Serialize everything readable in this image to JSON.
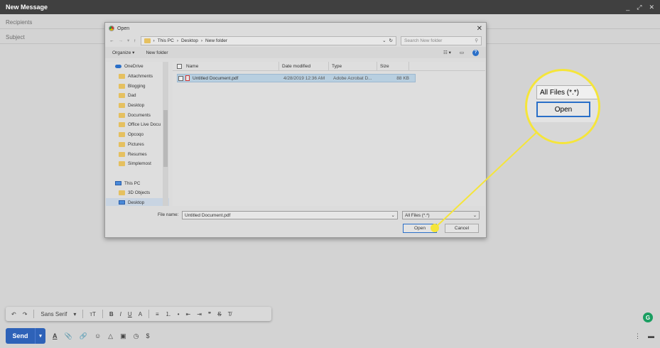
{
  "compose": {
    "title": "New Message",
    "minimize": "_",
    "expand": "⤢",
    "close": "✕",
    "recipients_placeholder": "Recipients",
    "subject_placeholder": "Subject"
  },
  "format_toolbar": {
    "font": "Sans Serif",
    "undo": "↶",
    "redo": "↷",
    "size": "тT",
    "bold": "B",
    "italic": "I",
    "underline": "U",
    "color": "A",
    "align": "≡",
    "numbered": "⒈",
    "bulleted": "•",
    "indent_less": "⇤",
    "indent_more": "⇥",
    "quote": "❞",
    "strike": "S",
    "clear": "T̸"
  },
  "bottom_bar": {
    "send_label": "Send",
    "send_more": "▾",
    "dollar": "$",
    "more": "⋮",
    "trash": "🗑"
  },
  "grammarly": "G",
  "dialog": {
    "title": "Open",
    "close": "✕",
    "breadcrumb": [
      "This PC",
      "Desktop",
      "New folder"
    ],
    "search_placeholder": "Search New folder",
    "organize": "Organize ▾",
    "new_folder": "New folder",
    "help": "?",
    "nav_items": [
      {
        "label": "OneDrive",
        "type": "cloud"
      },
      {
        "label": "Attachments",
        "type": "folder"
      },
      {
        "label": "Blogging",
        "type": "folder"
      },
      {
        "label": "Dad",
        "type": "folder"
      },
      {
        "label": "Desktop",
        "type": "folder"
      },
      {
        "label": "Documents",
        "type": "folder"
      },
      {
        "label": "Office Live Docu",
        "type": "folder"
      },
      {
        "label": "Opcoqo",
        "type": "folder"
      },
      {
        "label": "Pictures",
        "type": "folder"
      },
      {
        "label": "Resumes",
        "type": "folder"
      },
      {
        "label": "Simplemost",
        "type": "folder"
      },
      {
        "label": "",
        "type": "blank"
      },
      {
        "label": "This PC",
        "type": "pc"
      },
      {
        "label": "3D Objects",
        "type": "folder"
      },
      {
        "label": "Desktop",
        "type": "pc",
        "selected": true
      }
    ],
    "columns": [
      "Name",
      "Date modified",
      "Type",
      "Size"
    ],
    "files": [
      {
        "name": "Untitled Document.pdf",
        "date": "4/28/2019 12:36 AM",
        "type": "Adobe Acrobat D...",
        "size": "88 KB"
      }
    ],
    "file_name_label": "File name:",
    "file_name_value": "Untitled Document.pdf",
    "file_type": "All Files (*.*)",
    "open_label": "Open",
    "cancel_label": "Cancel"
  },
  "magnifier": {
    "file_type": "All Files (*.*)",
    "open_label": "Open"
  }
}
